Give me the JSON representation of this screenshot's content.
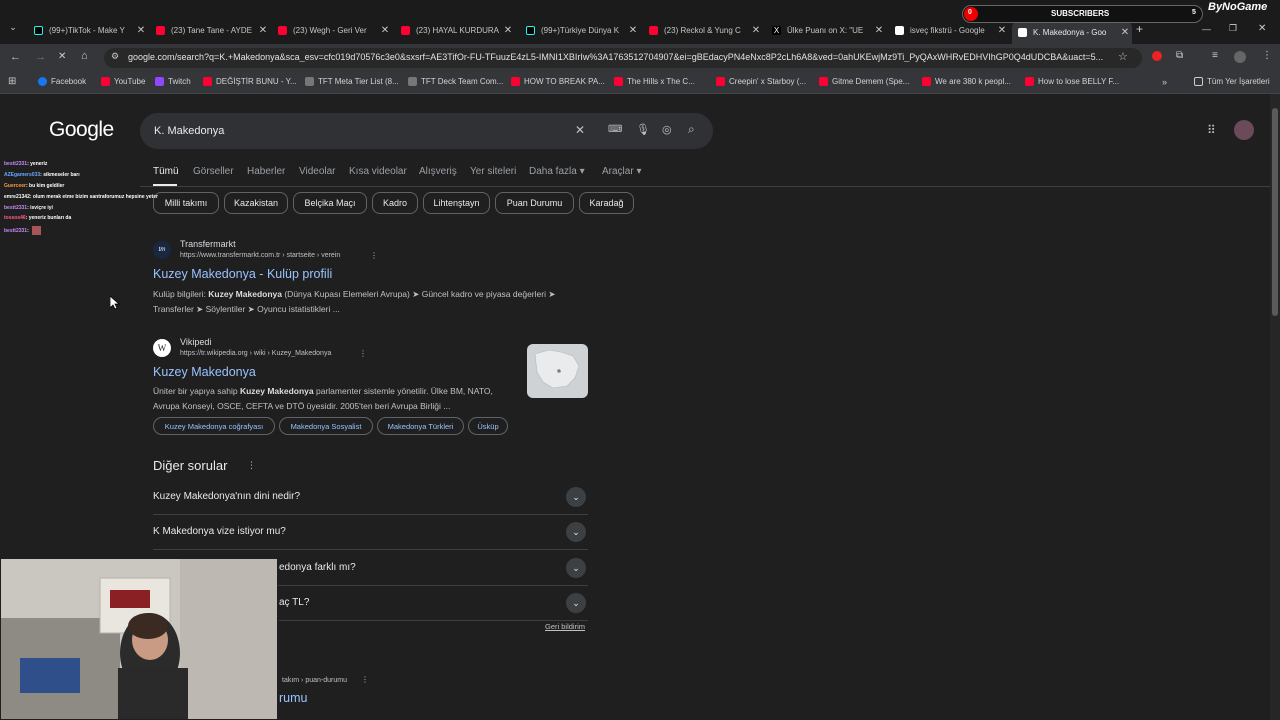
{
  "browser": {
    "tabs": [
      {
        "title": "(99+)TikTok - Make Y",
        "icon": "tiktok-icon"
      },
      {
        "title": "(23) Tane Tane - AYDE",
        "icon": "youtube-icon"
      },
      {
        "title": "(23) Wegh - Geri Ver",
        "icon": "youtube-icon"
      },
      {
        "title": "(23) HAYAL KURDURA",
        "icon": "youtube-icon"
      },
      {
        "title": "(99+)Türkiye Dünya K",
        "icon": "tiktok-icon"
      },
      {
        "title": "(23) Reckol & Yung C",
        "icon": "youtube-icon"
      },
      {
        "title": "Ülke Puanı on X: \"UE",
        "icon": "x-icon"
      },
      {
        "title": "isveç fikstrü - Google",
        "icon": "google-icon"
      },
      {
        "title": "K. Makedonya - Goo",
        "icon": "google-icon",
        "active": true
      }
    ],
    "url": "google.com/search?q=K.+Makedonya&sca_esv=cfc019d70576c3e0&sxsrf=AE3TifOr-FU-TFuuzE4zL5-IMNI1XBIrIw%3A1763512704907&ei=gBEdacyPN4eNxc8P2cLh6A8&ved=0ahUKEwjMz9Ti_PyQAxWHRvEDHVIhGP0Q4dUDCBA&uact=5...",
    "bookmarks": [
      {
        "label": "Facebook",
        "color": "#1877f2"
      },
      {
        "label": "YouTube",
        "color": "#ff0033"
      },
      {
        "label": "Twitch",
        "color": "#9146ff"
      },
      {
        "label": "DEĞİŞTİR BUNU - Y...",
        "color": "#ff0033"
      },
      {
        "label": "TFT Meta Tier List (8...",
        "color": "#888888"
      },
      {
        "label": "TFT Deck Team Com...",
        "color": "#888888"
      },
      {
        "label": "HOW TO BREAK PA...",
        "color": "#ff0033"
      },
      {
        "label": "The Hills x The C...",
        "color": "#ff0033"
      },
      {
        "label": "Creepin' x Starboy (...",
        "color": "#ff0033"
      },
      {
        "label": "Gitme Demem (Spe...",
        "color": "#ff0033"
      },
      {
        "label": "We are 380 k peopl...",
        "color": "#ff0033"
      },
      {
        "label": "How to lose BELLY F...",
        "color": "#ff0033"
      }
    ],
    "all_bookmarks": "Tüm Yer İşaretleri"
  },
  "overlay": {
    "subs_left": "0",
    "subs_label": "SUBSCRIBERS",
    "subs_right": "5",
    "brand": "ByNoGame",
    "chat": [
      {
        "user": "bestt2331",
        "msg": ": yeneriz"
      },
      {
        "user": "AZEgamers033",
        "msg": ": sikmeseler barı"
      },
      {
        "user": "Guerceer",
        "msg": ": bu kim geldiler"
      },
      {
        "user": "emre21342",
        "msg": ": olum merak etme bizim santraforumuz hepsine yeter"
      },
      {
        "user": "bestt2331",
        "msg": ": isviçre iyi"
      },
      {
        "user": "tossos46",
        "msg": ": yeneriz bunları da"
      },
      {
        "user": "bestt2331",
        "msg": ": "
      }
    ]
  },
  "google": {
    "logo": "Google",
    "query": "K. Makedonya",
    "nav": [
      "Tümü",
      "Görseller",
      "Haberler",
      "Videolar",
      "Kısa videolar",
      "Alışveriş",
      "Yer siteleri",
      "Daha fazla",
      "Araçlar"
    ],
    "chips": [
      "Milli takımı",
      "Kazakistan",
      "Belçika Maçı",
      "Kadro",
      "Lihtenştayn",
      "Puan Durumu",
      "Karadağ"
    ],
    "results": [
      {
        "site": "Transfermarkt",
        "cite": "https://www.transfermarkt.com.tr › startseite › verein",
        "title": "Kuzey Makedonya - Kulüp profili",
        "snippet_pre": "Kulüp bilgileri: ",
        "snippet_bold": "Kuzey Makedonya",
        "snippet_post": " (Dünya Kupası Elemeleri Avrupa) ➤ Güncel kadro ve piyasa değerleri ➤ Transferler ➤ Söylentiler ➤ Oyuncu istatistikleri ..."
      },
      {
        "site": "Vikipedi",
        "cite": "https://tr.wikipedia.org › wiki › Kuzey_Makedonya",
        "title": "Kuzey Makedonya",
        "snippet_pre": "Üniter bir yapıya sahip ",
        "snippet_bold": "Kuzey Makedonya",
        "snippet_post": " parlamenter sistemle yönetilir. Ülke BM, NATO, Avrupa Konseyi, OSCE, CEFTA ve DTÖ üyesidir. 2005'ten beri Avrupa Birliği ...",
        "sublinks": [
          "Kuzey Makedonya coğrafyası",
          "Makedonya Sosyalist",
          "Makedonya Türkleri",
          "Üsküp"
        ]
      }
    ],
    "faq_title": "Diğer sorular",
    "faqs": [
      "Kuzey Makedonya'nın dini nedir?",
      "K Makedonya vize istiyor mu?",
      "edonya farklı mı?",
      "aç TL?"
    ],
    "feedback": "Geri bildirim",
    "partial_cite": "takım › puan-durumu",
    "partial_title": "rumu"
  }
}
